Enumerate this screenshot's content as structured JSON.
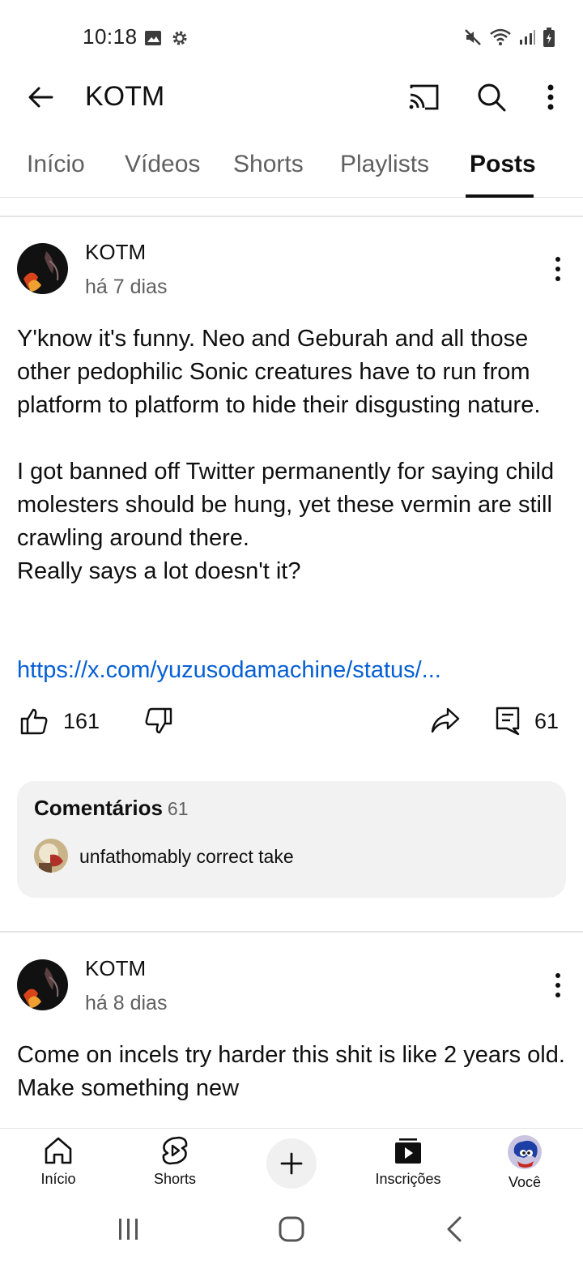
{
  "status_bar": {
    "time": "10:18"
  },
  "app_bar": {
    "title": "KOTM"
  },
  "tabs": [
    {
      "label": "Início"
    },
    {
      "label": "Vídeos"
    },
    {
      "label": "Shorts"
    },
    {
      "label": "Playlists"
    },
    {
      "label": "Posts",
      "active": true
    }
  ],
  "posts": [
    {
      "author": "KOTM",
      "time": "há 7 dias",
      "paragraph1": "Y'know it's funny. Neo and Geburah and all those other pedophilic Sonic creatures have to run from platform to platform to hide their disgusting nature.",
      "paragraph2": "I got banned off Twitter permanently for saying child molesters should be hung, yet these vermin are still crawling around there.\nReally says a lot doesn't it?",
      "link": "https://x.com/yuzusodamachine/status/...",
      "likes": "161",
      "comments": "61",
      "comments_label": "Comentários",
      "comments_count": "61",
      "top_comment": "unfathomably correct take"
    },
    {
      "author": "KOTM",
      "time": "há 8 dias",
      "text": "Come on incels try harder this shit is like 2 years old.\nMake something new"
    }
  ],
  "bottom_nav": {
    "home": "Início",
    "shorts": "Shorts",
    "subscriptions": "Inscrições",
    "you": "Você"
  },
  "colors": {
    "link": "#065fd4",
    "secondary_text": "#606060",
    "primary_text": "#0f0f0f",
    "comments_bg": "#f2f2f2"
  },
  "icons": [
    "back-arrow-icon",
    "cast-icon",
    "search-icon",
    "more-vert-icon",
    "like-icon",
    "dislike-icon",
    "share-icon",
    "comment-icon",
    "home-icon",
    "shorts-icon",
    "add-icon",
    "subscriptions-icon"
  ]
}
